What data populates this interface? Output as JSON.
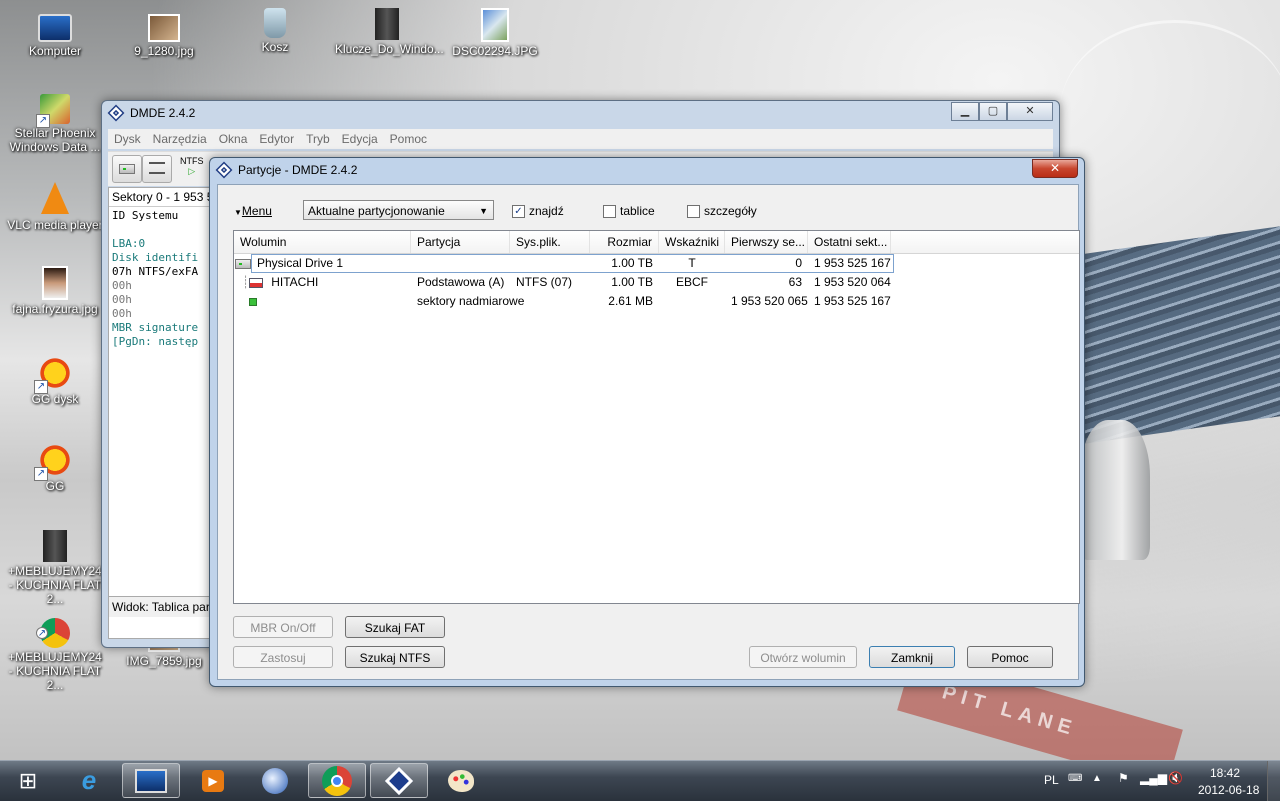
{
  "desktop": {
    "icons": [
      {
        "label": "Komputer",
        "icon": "computer-icon"
      },
      {
        "label": "9_1280.jpg",
        "icon": "image-file-icon"
      },
      {
        "label": "Kosz",
        "icon": "recycle-bin-icon"
      },
      {
        "label": "Klucze_Do_Windo...",
        "icon": "book-file-icon"
      },
      {
        "label": "DSC02294.JPG",
        "icon": "image-file-icon"
      },
      {
        "label": "Stellar Phoenix Windows Data ...",
        "icon": "stellar-phoenix-icon"
      },
      {
        "label": "VLC media player",
        "icon": "vlc-icon"
      },
      {
        "label": "fajna.fryzura.jpg",
        "icon": "image-file-icon"
      },
      {
        "label": "GG dysk",
        "icon": "gg-dysk-icon"
      },
      {
        "label": "GG",
        "icon": "gg-icon"
      },
      {
        "label": "+MEBLUJEMY24 - KUCHNIA FLAT 2...",
        "icon": "book-file-icon"
      },
      {
        "label": "+MEBLUJEMY24 - KUCHNIA FLAT 2...",
        "icon": "chrome-icon"
      },
      {
        "label": "IMG_7859.jpg",
        "icon": "image-file-icon"
      }
    ],
    "wallpaper_text": "PIT LANE"
  },
  "main_window": {
    "title": "DMDE 2.4.2",
    "menu": [
      "Dysk",
      "Narzędzia",
      "Okna",
      "Edytor",
      "Tryb",
      "Edycja",
      "Pomoc"
    ],
    "toolbar_ntfs": "NTFS",
    "sectors_label": "Sektory 0 - 1 953 5",
    "panel_header": "ID Systemu",
    "panel_lines": [
      "LBA:0",
      "Disk identifi",
      "07h NTFS/exFA",
      "00h",
      "00h",
      "00h",
      "MBR signature",
      "[PgDn: następ"
    ],
    "status": "Widok: Tablica par"
  },
  "dialog": {
    "title": "Partycje - DMDE 2.4.2",
    "menu_label": "Menu",
    "combo_value": "Aktualne partycjonowanie",
    "checkboxes": [
      {
        "label": "znajdź",
        "checked": true
      },
      {
        "label": "tablice",
        "checked": false
      },
      {
        "label": "szczegóły",
        "checked": false
      }
    ],
    "columns": [
      "Wolumin",
      "Partycja",
      "Sys.plik.",
      "Rozmiar",
      "Wskaźniki",
      "Pierwszy se...",
      "Ostatni sekt..."
    ],
    "rows": [
      {
        "wolumin": "Physical Drive 1",
        "partycja": "",
        "sys": "",
        "rozmiar": "1.00 TB",
        "wskazniki": "T",
        "pierwszy": "0",
        "ostatni": "1 953 525 167"
      },
      {
        "wolumin": "HITACHI",
        "partycja": "Podstawowa (A)",
        "sys": "NTFS (07)",
        "rozmiar": "1.00 TB",
        "wskazniki": "EBCF",
        "pierwszy": "63",
        "ostatni": "1 953 520 064"
      },
      {
        "wolumin": "",
        "partycja": "sektory nadmiarowe",
        "sys": "",
        "rozmiar": "2.61 MB",
        "wskazniki": "",
        "pierwszy": "1 953 520 065",
        "ostatni": "1 953 525 167"
      }
    ],
    "buttons": {
      "mbr": "MBR On/Off",
      "fat": "Szukaj FAT",
      "apply": "Zastosuj",
      "ntfs": "Szukaj NTFS",
      "open": "Otwórz wolumin",
      "close": "Zamknij",
      "help": "Pomoc"
    }
  },
  "taskbar": {
    "items": [
      "ie-icon",
      "computer-icon",
      "media-player-icon",
      "thunderbird-icon",
      "chrome-icon",
      "dmde-icon",
      "paint-icon"
    ],
    "language": "PL",
    "time": "18:42",
    "date": "2012-06-18"
  }
}
